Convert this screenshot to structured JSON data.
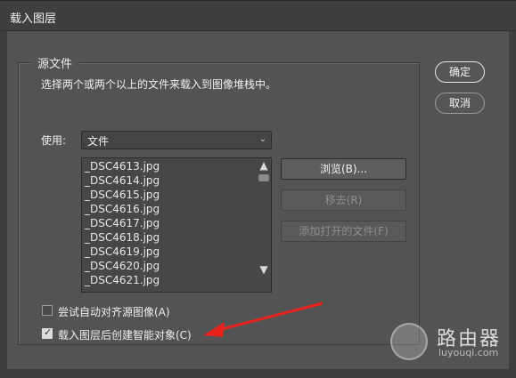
{
  "window": {
    "title": "载入图层"
  },
  "group": {
    "legend": "源文件",
    "instruction": "选择两个或两个以上的文件来载入到图像堆栈中。"
  },
  "use": {
    "label": "使用:",
    "selected": "文件",
    "chevron_icon": "chevron-down-icon"
  },
  "files": [
    "_DSC4613.jpg",
    "_DSC4614.jpg",
    "_DSC4615.jpg",
    "_DSC4616.jpg",
    "_DSC4617.jpg",
    "_DSC4618.jpg",
    "_DSC4619.jpg",
    "_DSC4620.jpg",
    "_DSC4621.jpg"
  ],
  "buttons": {
    "browse": "浏览(B)...",
    "remove": "移去(R)",
    "add_open": "添加打开的文件(F)",
    "ok": "确定",
    "cancel": "取消"
  },
  "options": {
    "align": {
      "label": "尝试自动对齐源图像(A)",
      "checked": false
    },
    "smart_object": {
      "label": "载入图层后创建智能对象(C)",
      "checked": true
    }
  },
  "watermark": {
    "title": "路由器",
    "subtitle": "luyouqi.com"
  },
  "colors": {
    "dialog_bg": "#535353",
    "titlebar_bg": "#3f3f3f",
    "arrow": "#e8231d"
  }
}
